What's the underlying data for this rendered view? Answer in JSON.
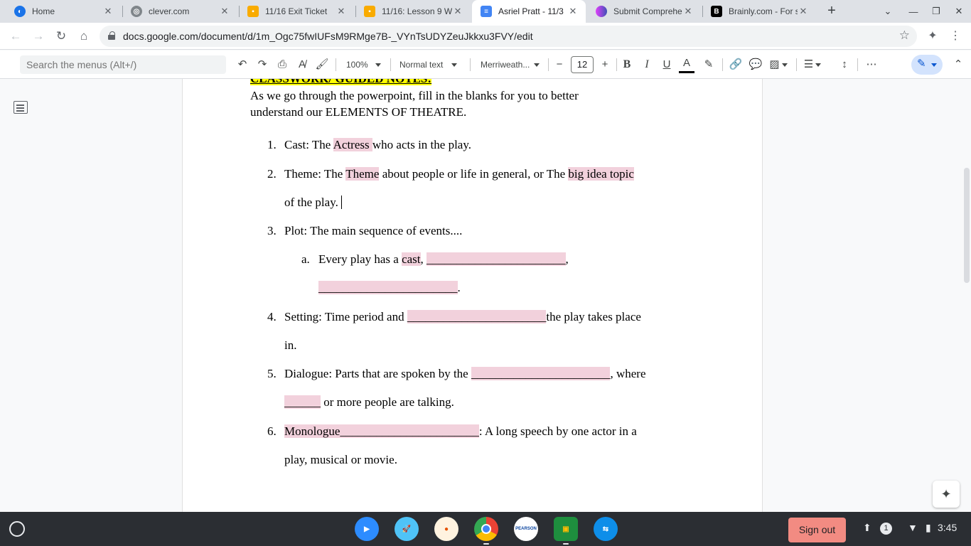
{
  "tabs": [
    {
      "label": "Home",
      "icon": "globe-blue-icon",
      "color": "#1a73e8"
    },
    {
      "label": "clever.com",
      "icon": "globe-icon",
      "color": "#5f6368"
    },
    {
      "label": "11/16 Exit Ticket",
      "icon": "google-classroom-icon",
      "color": "#f9ab00"
    },
    {
      "label": "11/16: Lesson 9 W",
      "icon": "google-classroom-icon",
      "color": "#f9ab00"
    },
    {
      "label": "Asriel Pratt - 11/3",
      "icon": "google-docs-icon",
      "color": "#4285f4"
    },
    {
      "label": "Submit Comprehe",
      "icon": "quiz-logo-icon",
      "color": "#e040fb"
    },
    {
      "label": "Brainly.com - For s",
      "icon": "brainly-icon",
      "color": "#000000"
    }
  ],
  "address": {
    "url": "docs.google.com/document/d/1m_Ogc75fwIUFsM9RMge7B-_VYnTsUDYZeuJkkxu3FVY/edit"
  },
  "toolbar": {
    "search_placeholder": "Search the menus (Alt+/)",
    "zoom": "100%",
    "style": "Normal text",
    "font": "Merriweath...",
    "font_size": "12",
    "minus": "−",
    "plus": "+"
  },
  "document": {
    "heading": "CLASSWORK/ GUIDED NOTES:",
    "intro_line1": "As we go through the powerpoint, fill in the blanks for you to better",
    "intro_line2": "understand our ELEMENTS OF THEATRE.",
    "items": {
      "n1": "1.",
      "i1_pre": "Cast: The ",
      "i1_fill": " Actress ",
      "i1_post": "who acts in the play.",
      "n2": "2.",
      "i2_pre": "Theme: The ",
      "i2_fill1": "Theme",
      "i2_mid": " about people or life in general, or The ",
      "i2_fill2": "big idea topic",
      "i2_line2": "of the play.",
      "n3": "3.",
      "i3": "Plot: The main sequence of events....",
      "na": "a.",
      "ia_pre": "Every play has a ",
      "ia_fill1": " cast",
      "ia_comma": ", ",
      "ia_fill2": "_______________________",
      "ia_end": ",",
      "ia_line2_fill": "_______________________",
      "ia_line2_end": ".",
      "n4": "4.",
      "i4_pre": "Setting: Time period and ",
      "i4_fill": "_______________________",
      "i4_post": "the play takes place",
      "i4_line2": "in.",
      "n5": "5.",
      "i5_pre": "Dialogue: Parts that are spoken by the ",
      "i5_fill": "_______________________",
      "i5_post": ", where",
      "i5_line2_fill": "______",
      "i5_line2_post": " or more people are talking.",
      "n6": "6.",
      "i6_fill": " Monologue_______________________",
      "i6_post": ": A long speech by one actor in a",
      "i6_line2": "play, musical or movie."
    }
  },
  "shelf": {
    "sign_out": "Sign out",
    "notifications": "1",
    "time": "3:45",
    "apps": [
      {
        "icon": "zoom-icon",
        "color": "#2d8cff"
      },
      {
        "icon": "rocket-icon",
        "color": "#4fc3f7"
      },
      {
        "icon": "app-circle-icon",
        "color": "#fff3e0"
      },
      {
        "icon": "chrome-icon",
        "color": "#ea4335"
      },
      {
        "icon": "pearson-icon",
        "color": "#ffffff"
      },
      {
        "icon": "google-classroom-icon",
        "color": "#1e8e3e"
      },
      {
        "icon": "teamviewer-icon",
        "color": "#0e8ee9"
      }
    ],
    "pearson_label": "PEARSON"
  }
}
